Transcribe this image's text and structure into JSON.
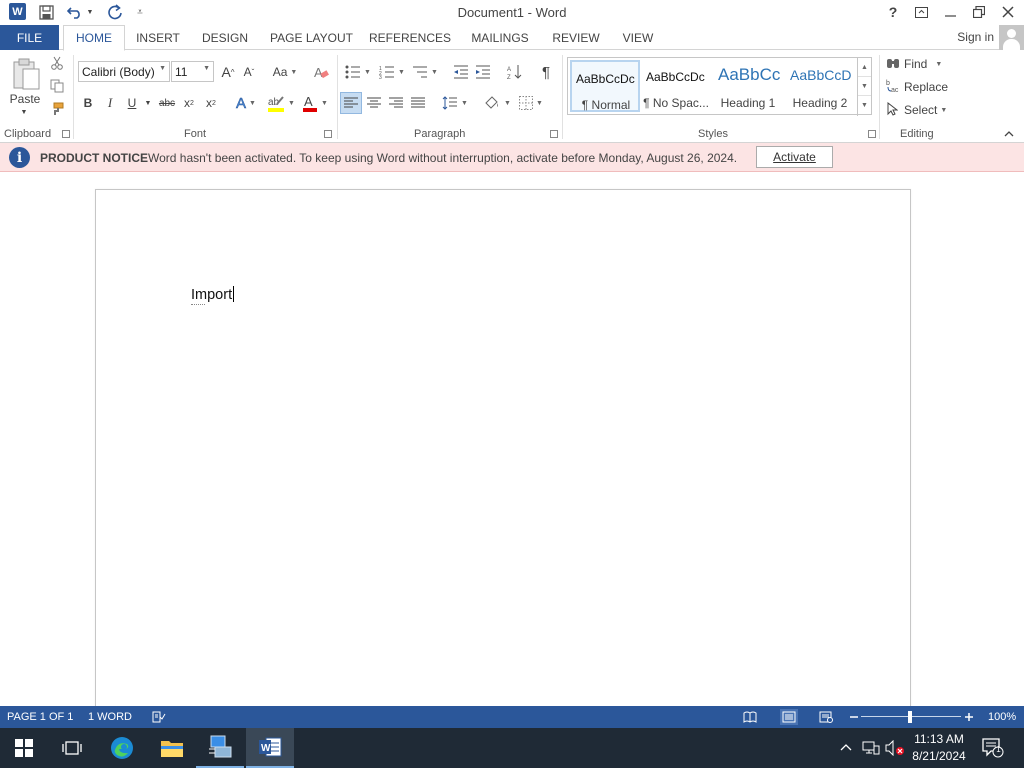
{
  "titlebar": {
    "title": "Document1 - Word",
    "help": "?"
  },
  "tabs": {
    "file": "FILE",
    "items": [
      "HOME",
      "INSERT",
      "DESIGN",
      "PAGE LAYOUT",
      "REFERENCES",
      "MAILINGS",
      "REVIEW",
      "VIEW"
    ],
    "active": "HOME",
    "signin": "Sign in"
  },
  "ribbon": {
    "clipboard": {
      "label": "Clipboard",
      "paste": "Paste"
    },
    "font": {
      "label": "Font",
      "font_name": "Calibri (Body)",
      "font_size": "11",
      "change_case": "Aa"
    },
    "paragraph": {
      "label": "Paragraph"
    },
    "styles": {
      "label": "Styles",
      "items": [
        {
          "preview": "AaBbCcDc",
          "name": "¶ Normal"
        },
        {
          "preview": "AaBbCcDc",
          "name": "¶ No Spac..."
        },
        {
          "preview": "AaBbCc",
          "name": "Heading 1"
        },
        {
          "preview": "AaBbCcD",
          "name": "Heading 2"
        }
      ]
    },
    "editing": {
      "label": "Editing",
      "find": "Find",
      "replace": "Replace",
      "select": "Select"
    }
  },
  "notice": {
    "title": "PRODUCT NOTICE",
    "text": "Word hasn't been activated. To keep using Word without interruption, activate before Monday, August 26, 2024.",
    "button": "Activate"
  },
  "document": {
    "text": "Import"
  },
  "statusbar": {
    "page": "PAGE 1 OF 1",
    "words": "1 WORD",
    "zoom": "100%",
    "zoom_level": 1.0
  },
  "taskbar": {
    "time": "11:13 AM",
    "date": "8/21/2024",
    "notifications": "1"
  },
  "colors": {
    "brand": "#2b579a",
    "notice_bg": "#fce4e4",
    "taskbar": "#1f2a36"
  }
}
